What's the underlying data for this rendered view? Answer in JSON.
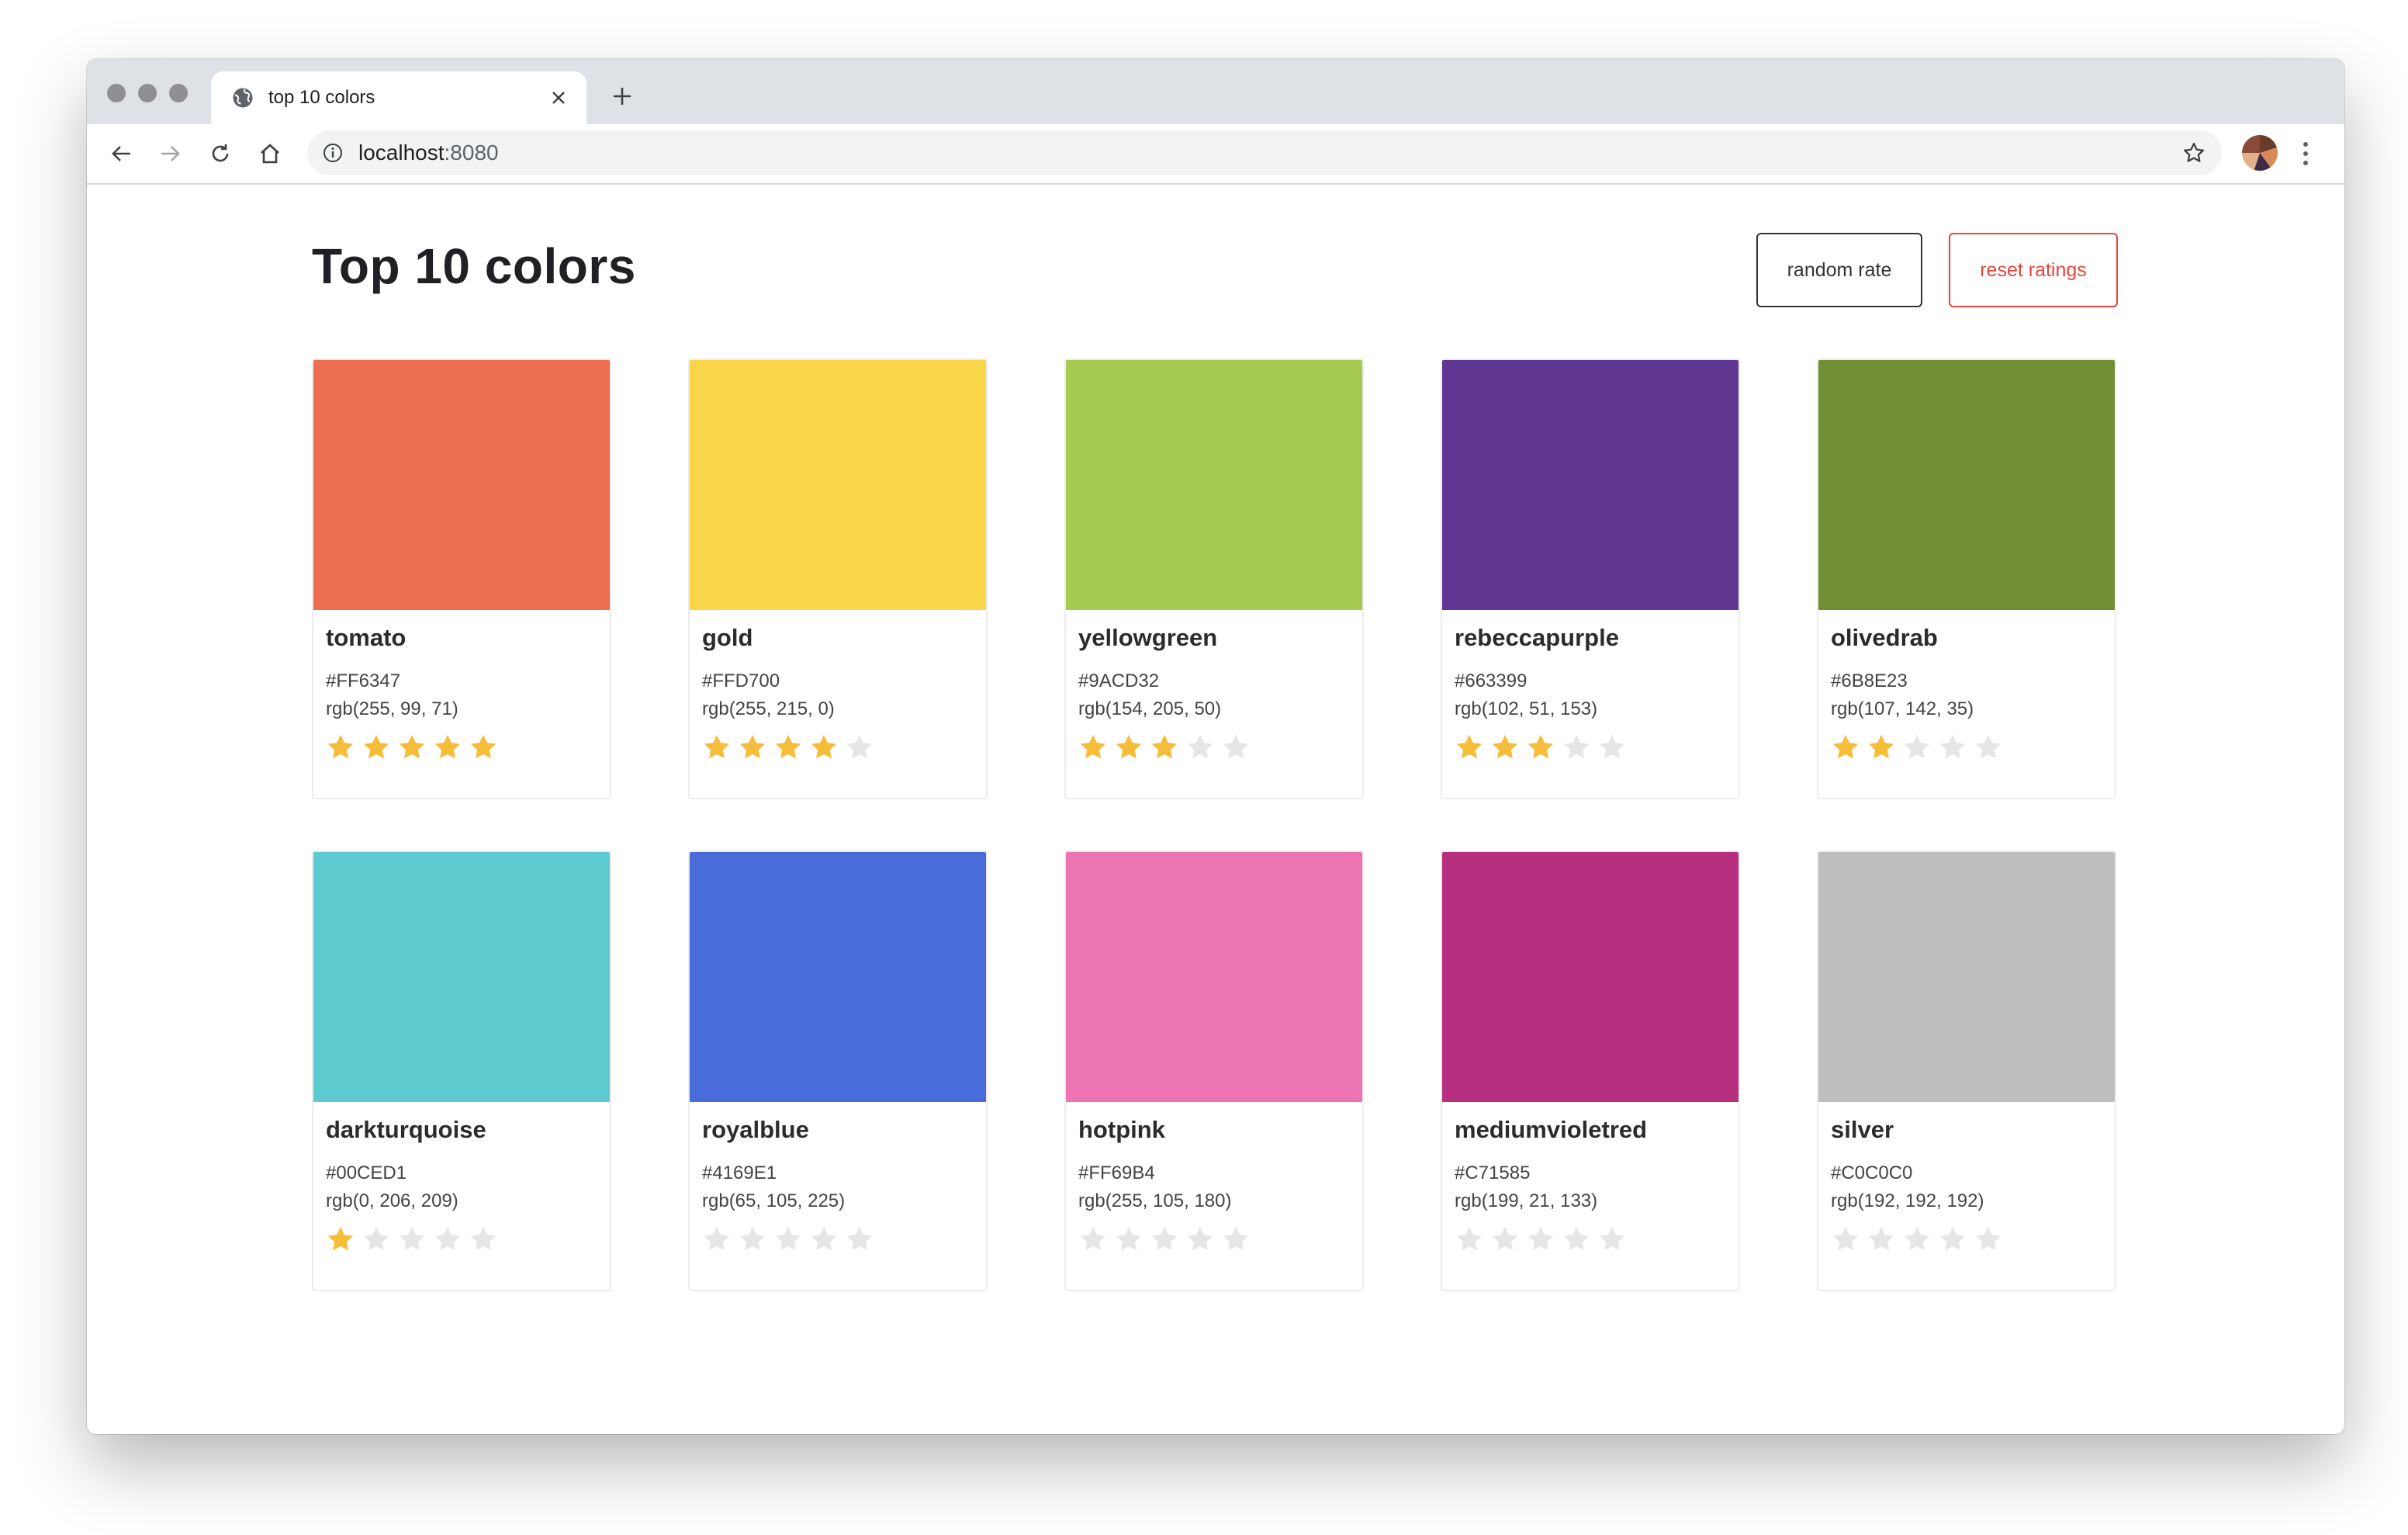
{
  "browser": {
    "tab_title": "top 10 colors",
    "url_host": "localhost",
    "url_port": ":8080"
  },
  "page": {
    "title": "Top 10 colors",
    "random_rate_label": "random rate",
    "reset_ratings_label": "reset ratings"
  },
  "colors": [
    {
      "name": "tomato",
      "hex": "#FF6347",
      "rgb": "rgb(255, 99, 71)",
      "swatch": "#ed6d51",
      "rating": 5
    },
    {
      "name": "gold",
      "hex": "#FFD700",
      "rgb": "rgb(255, 215, 0)",
      "swatch": "#f9d648",
      "rating": 4
    },
    {
      "name": "yellowgreen",
      "hex": "#9ACD32",
      "rgb": "rgb(154, 205, 50)",
      "swatch": "#a6c94f",
      "rating": 3
    },
    {
      "name": "rebeccapurple",
      "hex": "#663399",
      "rgb": "rgb(102, 51, 153)",
      "swatch": "#613794",
      "rating": 3
    },
    {
      "name": "olivedrab",
      "hex": "#6B8E23",
      "rgb": "rgb(107, 142, 35)",
      "swatch": "#728e35",
      "rating": 2
    },
    {
      "name": "darkturquoise",
      "hex": "#00CED1",
      "rgb": "rgb(0, 206, 209)",
      "swatch": "#5dcbcf",
      "rating": 1
    },
    {
      "name": "royalblue",
      "hex": "#4169E1",
      "rgb": "rgb(65, 105, 225)",
      "swatch": "#4a6bda",
      "rating": 0
    },
    {
      "name": "hotpink",
      "hex": "#FF69B4",
      "rgb": "rgb(255, 105, 180)",
      "swatch": "#ec74b2",
      "rating": 0
    },
    {
      "name": "mediumvioletred",
      "hex": "#C71585",
      "rgb": "rgb(199, 21, 133)",
      "swatch": "#b73080",
      "rating": 0
    },
    {
      "name": "silver",
      "hex": "#C0C0C0",
      "rgb": "rgb(192, 192, 192)",
      "swatch": "#bebebe",
      "rating": 0
    }
  ],
  "star_colors": {
    "filled": "#f6bd3b",
    "empty": "#e6e6e6"
  },
  "icons": [
    "globe-icon",
    "close-icon",
    "plus-icon",
    "back-arrow-icon",
    "forward-arrow-icon",
    "reload-icon",
    "home-icon",
    "info-icon",
    "bookmark-star-icon",
    "star-icon"
  ]
}
